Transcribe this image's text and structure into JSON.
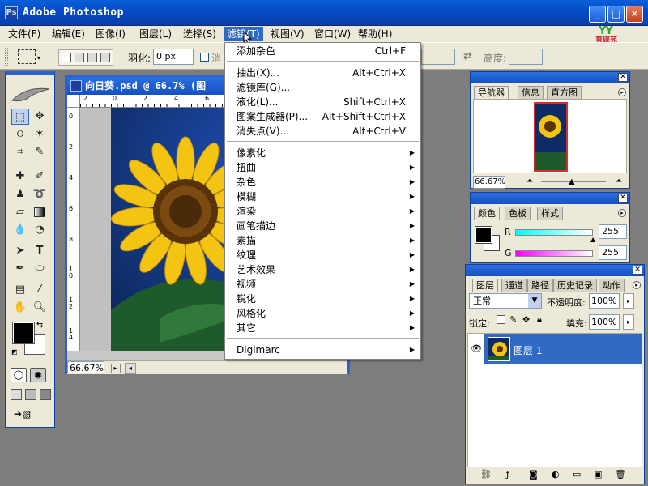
{
  "app": {
    "title": "Adobe Photoshop",
    "icon": "photoshop-icon"
  },
  "menubar": {
    "items": [
      {
        "label": "文件(F)"
      },
      {
        "label": "编辑(E)"
      },
      {
        "label": "图像(I)"
      },
      {
        "label": "图层(L)"
      },
      {
        "label": "选择(S)"
      },
      {
        "label": "滤镜(T)"
      },
      {
        "label": "视图(V)"
      },
      {
        "label": "窗口(W)"
      },
      {
        "label": "帮助(H)"
      }
    ],
    "active_index": 5
  },
  "watermark": {
    "glyphs": "YY",
    "text": "育碟苑"
  },
  "options": {
    "feather_label": "羽化:",
    "feather_value": "0 px",
    "antialias_label": "消",
    "height_label": "高度:"
  },
  "document": {
    "title": "向日葵.psd @ 66.7% (图",
    "zoom": "66.67%",
    "ruler_top": [
      "2",
      "0",
      "2",
      "4",
      "6"
    ],
    "ruler_left": [
      "0",
      "2",
      "4",
      "6",
      "8",
      "1 0",
      "1 2",
      "1 4"
    ]
  },
  "filter_menu": {
    "top_items": [
      {
        "label": "添加杂色",
        "shortcut": "Ctrl+F"
      }
    ],
    "group_items": [
      {
        "label": "抽出(X)...",
        "shortcut": "Alt+Ctrl+X"
      },
      {
        "label": "滤镜库(G)...",
        "shortcut": ""
      },
      {
        "label": "液化(L)...",
        "shortcut": "Shift+Ctrl+X"
      },
      {
        "label": "图案生成器(P)...",
        "shortcut": "Alt+Shift+Ctrl+X"
      },
      {
        "label": "消失点(V)...",
        "shortcut": "Alt+Ctrl+V"
      }
    ],
    "submenus": [
      "像素化",
      "扭曲",
      "杂色",
      "模糊",
      "渲染",
      "画笔描边",
      "素描",
      "纹理",
      "艺术效果",
      "视频",
      "锐化",
      "风格化",
      "其它"
    ],
    "bottom_item": "Digimarc"
  },
  "navigator": {
    "tabs": [
      "导航器",
      "信息",
      "直方图"
    ],
    "zoom": "66.67%"
  },
  "color": {
    "tabs": [
      "颜色",
      "色板",
      "样式"
    ],
    "r_label": "R",
    "r_value": "255",
    "g_label": "G",
    "g_value": "255"
  },
  "layers": {
    "tabs": [
      "图层",
      "通道",
      "路径",
      "历史记录",
      "动作"
    ],
    "blend_mode": "正常",
    "opacity_label": "不透明度:",
    "opacity": "100%",
    "lock_label": "锁定:",
    "fill_label": "填充:",
    "fill": "100%",
    "layer_name": "图层 1"
  },
  "colors": {
    "titlebar": "#0a5fd8",
    "menu_highlight": "#316ac5",
    "selected_layer": "#316ac5",
    "background": "#7d7d7d"
  }
}
